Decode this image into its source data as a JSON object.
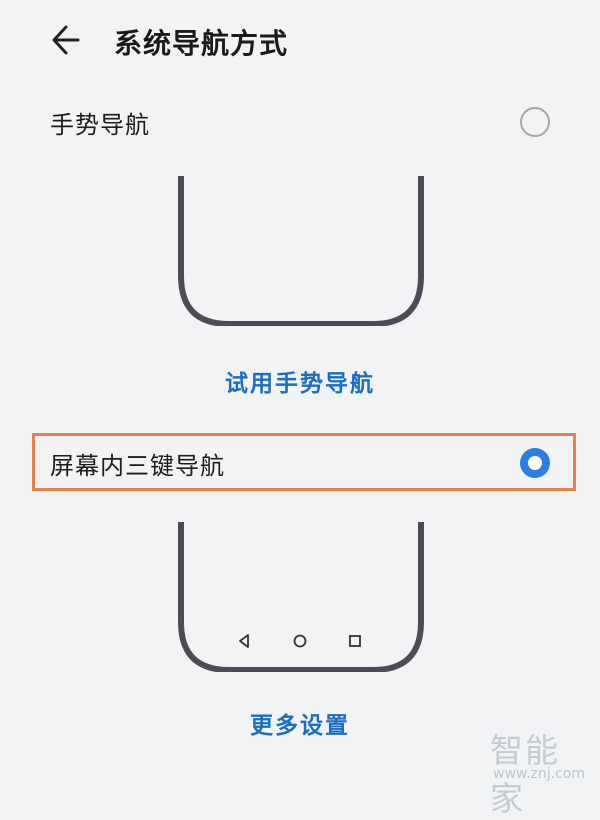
{
  "header": {
    "back_icon": "arrow-left-icon",
    "title": "系统导航方式"
  },
  "options": [
    {
      "label": "手势导航",
      "selected": false,
      "preview_icon": "phone-outline-gesture-icon",
      "link_label": "试用手势导航"
    },
    {
      "label": "屏幕内三键导航",
      "selected": true,
      "preview_icon": "phone-outline-three-key-icon",
      "nav_keys": [
        "back-triangle-icon",
        "home-circle-icon",
        "recents-square-icon"
      ],
      "link_label": "更多设置"
    }
  ],
  "colors": {
    "background": "#f1f3f5",
    "accent": "#2a7fe0",
    "link": "#1a6ec4",
    "highlight_border": "#ee7d4f",
    "phone_outline": "#4a4d55"
  },
  "watermark": {
    "brand": "智能家",
    "url": "www.znj.com"
  }
}
